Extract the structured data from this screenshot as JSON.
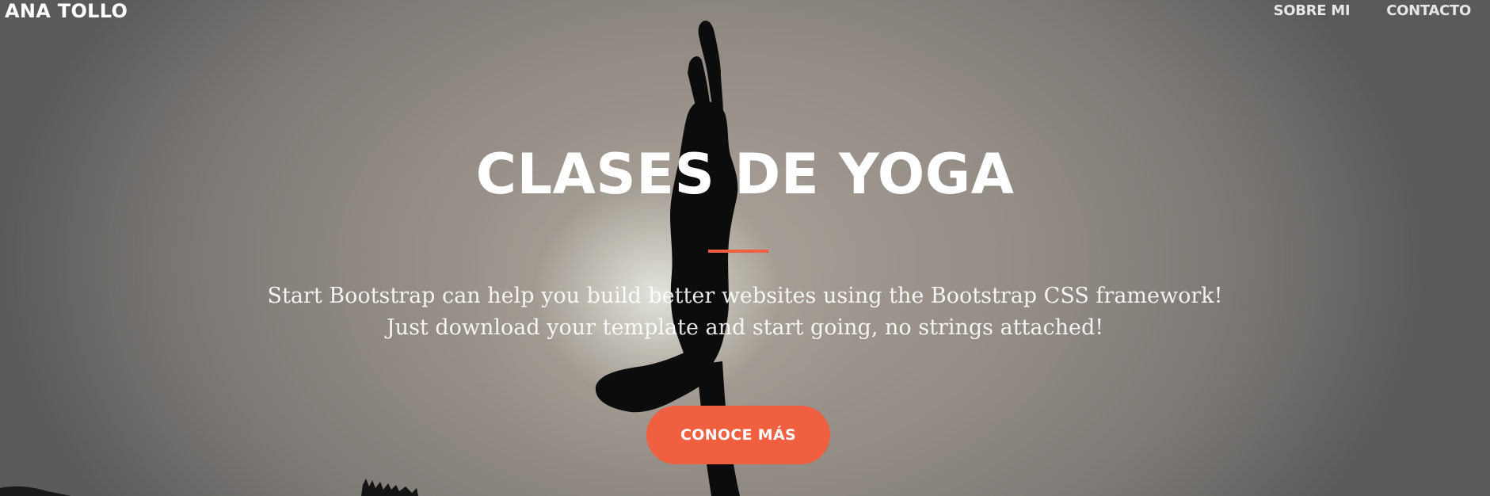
{
  "nav": {
    "brand": "ANA TOLLO",
    "links": [
      {
        "label": "SOBRE MI"
      },
      {
        "label": "CONTACTO"
      }
    ]
  },
  "hero": {
    "title": "CLASES DE YOGA",
    "lead_line1": "Start Bootstrap can help you build better websites using the Bootstrap CSS framework!",
    "lead_line2": "Just download your template and start going, no strings attached!",
    "cta_label": "CONOCE MÁS",
    "background_image": "yoga-silhouette-backlit-by-sun"
  },
  "colors": {
    "accent": "#f05f40",
    "text": "#ffffff"
  }
}
